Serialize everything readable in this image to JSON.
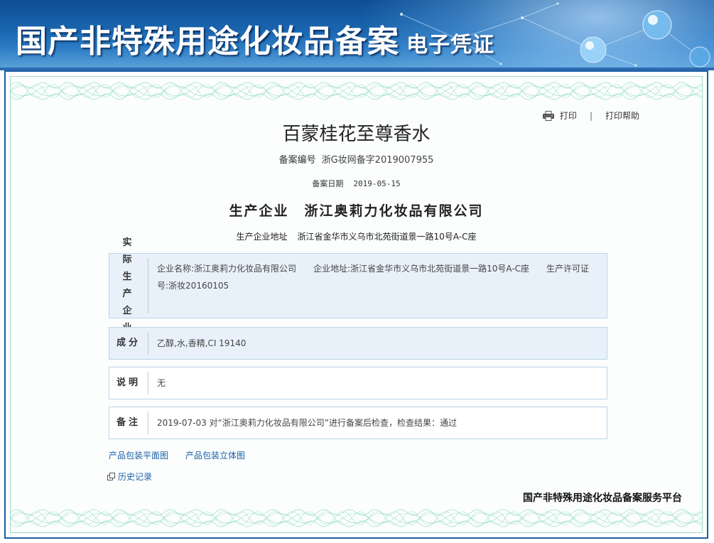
{
  "banner": {
    "title": "国产非特殊用途化妆品备案",
    "subtitle": "电子凭证"
  },
  "print_tools": {
    "print_label": "打印",
    "separator": "|",
    "help_label": "打印帮助"
  },
  "product": {
    "name": "百蒙桂花至尊香水",
    "reg_no_label": "备案编号",
    "reg_no": "浙G妆网备字2019007955",
    "reg_date_label": "备案日期",
    "reg_date": "2019-05-15",
    "manufacturer_label": "生产企业",
    "manufacturer": "浙江奥莉力化妆品有限公司",
    "mfr_address_label": "生产企业地址",
    "mfr_address": "浙江省金华市义乌市北苑街道景一路10号A-C座"
  },
  "rows": {
    "actual_producer": {
      "label": "实际生产企业",
      "company_label": "企业名称:",
      "company": "浙江奥莉力化妆品有限公司",
      "address_label": "企业地址:",
      "address": "浙江省金华市义乌市北苑街道景一路10号A-C座",
      "license_label": "生产许可证号:",
      "license": "浙妆20160105"
    },
    "ingredients": {
      "label": "成分",
      "value": "乙醇,水,香精,CI 19140"
    },
    "notes": {
      "label": "说明",
      "value": "无"
    },
    "remark": {
      "label": "备注",
      "value": "2019-07-03 对“浙江奥莉力化妆品有限公司”进行备案后检查，检查结果：通过"
    }
  },
  "links": {
    "flat_pkg": "产品包装平面图",
    "solid_pkg": "产品包装立体图",
    "history": "历史记录"
  },
  "footer": {
    "platform": "国产非特殊用途化妆品备案服务平台"
  },
  "colors": {
    "banner": "#1a66b0",
    "frame_border": "#1c5ea7",
    "row_shade": "#e8f1fa",
    "link": "#1a5fa5",
    "guilloche": "#7fd1bd"
  }
}
